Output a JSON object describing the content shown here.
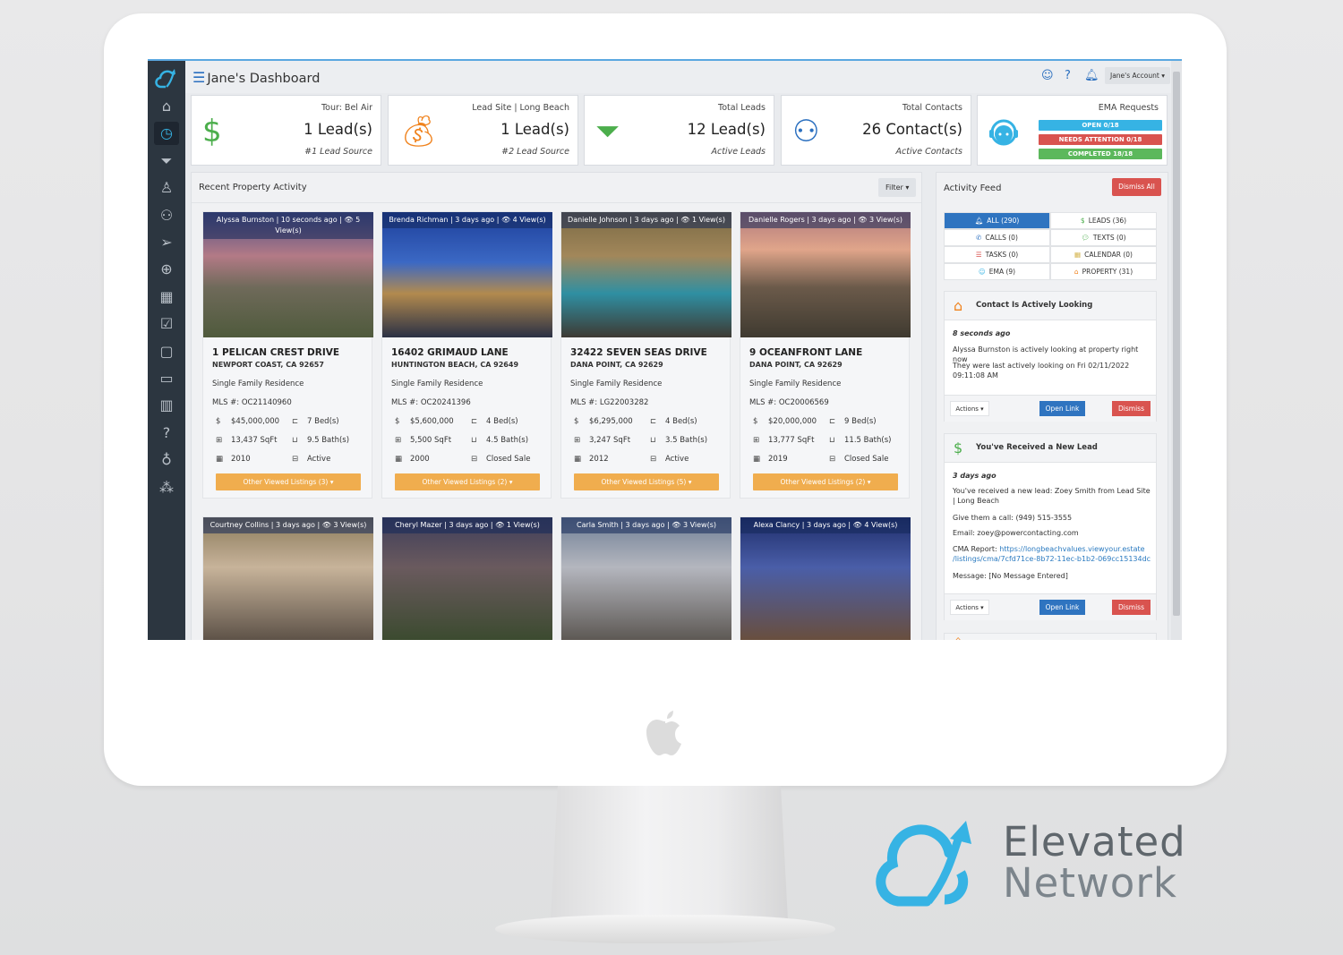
{
  "brand": {
    "line1": "Elevated",
    "line2": "Network",
    "color": "#36b3e4"
  },
  "header": {
    "title": "Jane's Dashboard",
    "account_label": "Jane's Account ▾",
    "icons": [
      "ema-icon",
      "help-icon",
      "bell-icon"
    ]
  },
  "sidebar": {
    "items": [
      {
        "icon": "home-icon",
        "glyph": "⌂"
      },
      {
        "icon": "dashboard-icon",
        "glyph": "◷",
        "active": true
      },
      {
        "icon": "leads-funnel-icon",
        "glyph": "⏷"
      },
      {
        "icon": "user-icon",
        "glyph": "♙"
      },
      {
        "icon": "contacts-icon",
        "glyph": "⚇"
      },
      {
        "icon": "send-icon",
        "glyph": "➢"
      },
      {
        "icon": "globe-icon",
        "glyph": "⊕"
      },
      {
        "icon": "calendar-icon",
        "glyph": "▦"
      },
      {
        "icon": "tasks-icon",
        "glyph": "☑"
      },
      {
        "icon": "notes-icon",
        "glyph": "▢"
      },
      {
        "icon": "folder-icon",
        "glyph": "▭"
      },
      {
        "icon": "reports-icon",
        "glyph": "▥"
      },
      {
        "icon": "help-icon",
        "glyph": "?"
      },
      {
        "icon": "money-bag-icon",
        "glyph": "♁"
      },
      {
        "icon": "network-icon",
        "glyph": "⁂"
      }
    ]
  },
  "stats": [
    {
      "label": "Tour: Bel Air",
      "value": "1 Lead(s)",
      "sub": "#1 Lead Source",
      "icon": "dollar-icon",
      "color": "#4cae4c"
    },
    {
      "label": "Lead Site | Long Beach",
      "value": "1 Lead(s)",
      "sub": "#2 Lead Source",
      "icon": "money-bag-icon",
      "color": "#f0831e"
    },
    {
      "label": "Total Leads",
      "value": "12 Lead(s)",
      "sub": "Active Leads",
      "icon": "funnel-dollar-icon",
      "color": "#4cae4c"
    },
    {
      "label": "Total Contacts",
      "value": "26 Contact(s)",
      "sub": "Active Contacts",
      "icon": "contacts-icon",
      "color": "#2a6fbf"
    }
  ],
  "ema": {
    "label": "EMA Requests",
    "open": "OPEN 0/18",
    "attention": "NEEDS ATTENTION 0/18",
    "completed": "COMPLETED 18/18",
    "colors": {
      "open": "#36b3e4",
      "attention": "#d9534f",
      "completed": "#5cb85c"
    }
  },
  "recent": {
    "title": "Recent Property Activity",
    "filter_label": "Filter ▾"
  },
  "properties": [
    {
      "caption": "Alyssa Burnston | 10 seconds ago | 👁 5 View(s)",
      "address": "1 PELICAN CREST DRIVE",
      "city": "NEWPORT COAST, CA 92657",
      "type": "Single Family Residence",
      "mls": "MLS #: OC21140960",
      "price": "$45,000,000",
      "beds": "7 Bed(s)",
      "sqft": "13,437 SqFt",
      "baths": "9.5 Bath(s)",
      "year": "2010",
      "status": "Active",
      "button": "Other Viewed Listings (3) ▾"
    },
    {
      "caption": "Brenda Richman | 3 days ago | 👁 4 View(s)",
      "address": "16402 GRIMAUD LANE",
      "city": "HUNTINGTON BEACH, CA 92649",
      "type": "Single Family Residence",
      "mls": "MLS #: OC20241396",
      "price": "$5,600,000",
      "beds": "4 Bed(s)",
      "sqft": "5,500 SqFt",
      "baths": "4.5 Bath(s)",
      "year": "2000",
      "status": "Closed Sale",
      "button": "Other Viewed Listings (2) ▾"
    },
    {
      "caption": "Danielle Johnson | 3 days ago | 👁 1 View(s)",
      "address": "32422 SEVEN SEAS DRIVE",
      "city": "DANA POINT, CA 92629",
      "type": "Single Family Residence",
      "mls": "MLS #: LG22003282",
      "price": "$6,295,000",
      "beds": "4 Bed(s)",
      "sqft": "3,247 SqFt",
      "baths": "3.5 Bath(s)",
      "year": "2012",
      "status": "Active",
      "button": "Other Viewed Listings (5) ▾"
    },
    {
      "caption": "Danielle Rogers | 3 days ago | 👁 3 View(s)",
      "address": "9 OCEANFRONT LANE",
      "city": "DANA POINT, CA 92629",
      "type": "Single Family Residence",
      "mls": "MLS #: OC20006569",
      "price": "$20,000,000",
      "beds": "9 Bed(s)",
      "sqft": "13,777 SqFt",
      "baths": "11.5 Bath(s)",
      "year": "2019",
      "status": "Closed Sale",
      "button": "Other Viewed Listings (2) ▾"
    },
    {
      "caption": "Courtney Collins | 3 days ago | 👁 3 View(s)"
    },
    {
      "caption": "Cheryl Mazer | 3 days ago | 👁 1 View(s)"
    },
    {
      "caption": "Carla Smith | 3 days ago | 👁 3 View(s)"
    },
    {
      "caption": "Alexa Clancy | 3 days ago | 👁 4 View(s)"
    }
  ],
  "feed": {
    "title": "Activity Feed",
    "dismiss_all": "Dismiss All",
    "filters": [
      {
        "label": "ALL (290)",
        "icon": "bell-icon",
        "glyph": "🔔︎",
        "active": true
      },
      {
        "label": "LEADS (36)",
        "icon": "dollar-icon",
        "glyph": "$"
      },
      {
        "label": "CALLS (0)",
        "icon": "phone-icon",
        "glyph": "✆"
      },
      {
        "label": "TEXTS (0)",
        "icon": "chat-icon",
        "glyph": "💬︎"
      },
      {
        "label": "TASKS (0)",
        "icon": "task-list-icon",
        "glyph": "☰"
      },
      {
        "label": "CALENDAR (0)",
        "icon": "calendar-icon",
        "glyph": "▦"
      },
      {
        "label": "EMA (9)",
        "icon": "ema-icon",
        "glyph": "☺"
      },
      {
        "label": "PROPERTY (31)",
        "icon": "house-icon",
        "glyph": "⌂"
      }
    ],
    "notes": [
      {
        "title": "Contact Is Actively Looking",
        "icon": "house-icon",
        "time": "8 seconds ago",
        "lines": [
          "Alyssa Burnston is actively looking at property right now",
          "They were last actively looking on Fri 02/11/2022 09:11:08 AM"
        ],
        "actions": "Actions ▾",
        "open": "Open Link",
        "dismiss": "Dismiss"
      },
      {
        "title": "You've Received a New Lead",
        "icon": "dollar-icon",
        "time": "3 days ago",
        "lines": [
          "You've received a new lead: Zoey Smith from Lead Site | Long Beach",
          "Give them a call: (949) 515-3555",
          "Email: zoey@powercontacting.com"
        ],
        "cma_label": "CMA Report: ",
        "cma_link": "https://longbeachvalues.viewyour.estate /listings/cma/7cfd71ce-8b72-11ec-b1b2-069cc15134dc",
        "message": "Message: [No Message Entered]",
        "actions": "Actions ▾",
        "open": "Open Link",
        "dismiss": "Dismiss"
      }
    ]
  }
}
